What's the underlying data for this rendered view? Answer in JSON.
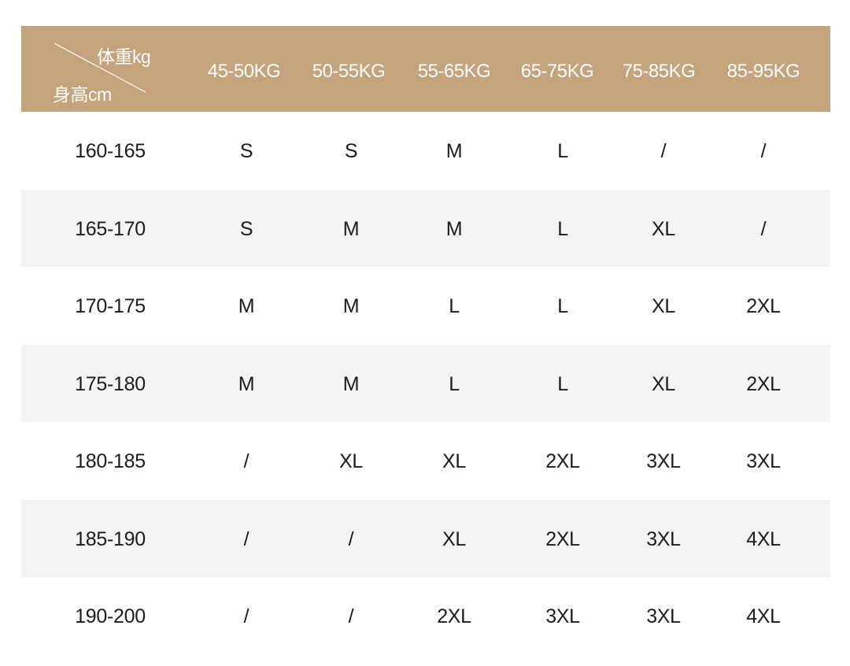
{
  "table": {
    "corner": {
      "weight_label": "体重kg",
      "height_label": "身高cm"
    },
    "columns": [
      "45-50KG",
      "50-55KG",
      "55-65KG",
      "65-75KG",
      "75-85KG",
      "85-95KG"
    ],
    "rows": [
      {
        "height": "160-165",
        "sizes": [
          "S",
          "S",
          "M",
          "L",
          "/",
          "/"
        ]
      },
      {
        "height": "165-170",
        "sizes": [
          "S",
          "M",
          "M",
          "L",
          "XL",
          "/"
        ]
      },
      {
        "height": "170-175",
        "sizes": [
          "M",
          "M",
          "L",
          "L",
          "XL",
          "2XL"
        ]
      },
      {
        "height": "175-180",
        "sizes": [
          "M",
          "M",
          "L",
          "L",
          "XL",
          "2XL"
        ]
      },
      {
        "height": "180-185",
        "sizes": [
          "/",
          "XL",
          "XL",
          "2XL",
          "3XL",
          "3XL"
        ]
      },
      {
        "height": "185-190",
        "sizes": [
          "/",
          "/",
          "XL",
          "2XL",
          "3XL",
          "4XL"
        ]
      },
      {
        "height": "190-200",
        "sizes": [
          "/",
          "/",
          "2XL",
          "3XL",
          "3XL",
          "4XL"
        ]
      }
    ]
  },
  "colors": {
    "header_bg": "#c5a47d",
    "header_text": "#ffffff",
    "shaded_row": "#f4f4f4",
    "body_text": "#1c1c1c"
  }
}
